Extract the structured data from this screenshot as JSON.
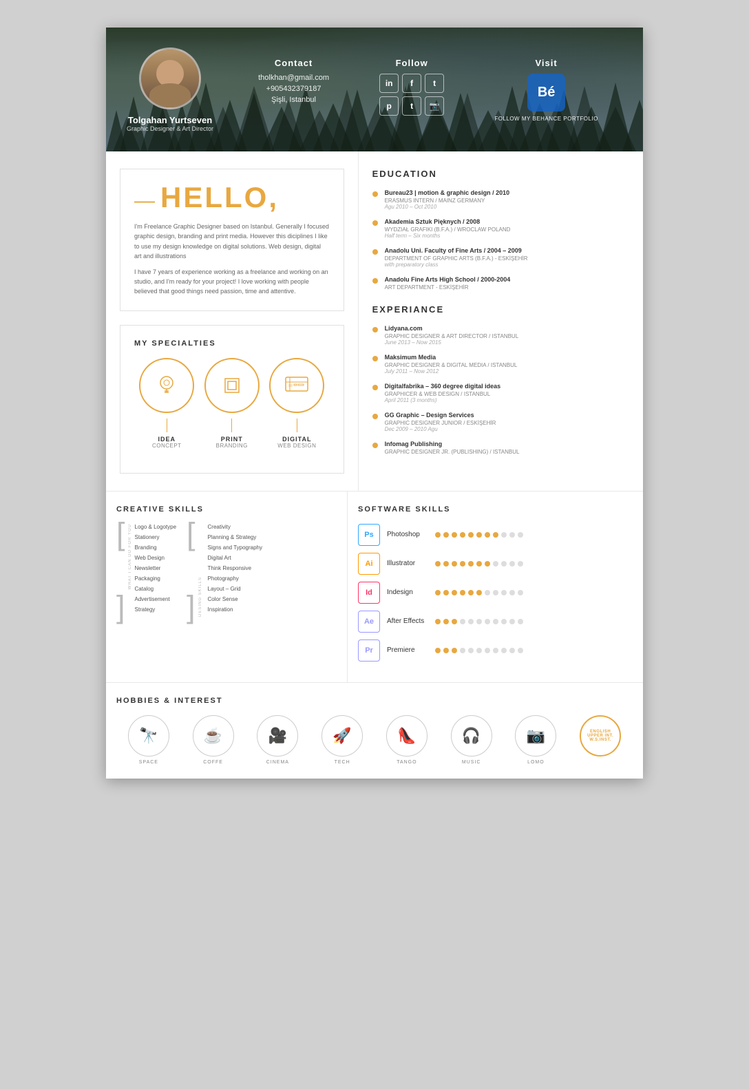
{
  "header": {
    "name": "Tolgahan Yurtseven",
    "title": "Graphic Designer & Art Director",
    "contact_title": "Contact",
    "email": "tholkhan@gmail.com",
    "phone": "+905432379187",
    "location": "Şişli, Istanbul",
    "follow_title": "Follow",
    "visit_title": "Visit",
    "behance_label": "FOLLOW MY BEHANCE PORTFOLIO",
    "social_icons": [
      "in",
      "f",
      "t",
      "p",
      "t",
      "📷"
    ]
  },
  "hello": {
    "greeting": "HELLO,",
    "dash": "—",
    "para1": "I'm Freelance Graphic Designer based on Istanbul. Generally I focused graphic design, branding and print media. However this diciplines I like to use my design knowledge on digital solutions. Web design, digital art and illustrations",
    "para2": "I have 7 years of experience working as a freelance and working on an studio, and I'm ready for your project! I love working with people believed that good things need passion, time and attentive."
  },
  "specialties": {
    "title": "MY SPECIALTIES",
    "items": [
      {
        "label": "IDEA",
        "sublabel": "CONCEPT",
        "icon": "💡"
      },
      {
        "label": "PRINT",
        "sublabel": "BRANDING",
        "icon": "🖨"
      },
      {
        "label": "DIGITAL",
        "sublabel": "WEB DESIGN",
        "icon": "🖥"
      }
    ]
  },
  "education": {
    "title": "EDUCATION",
    "items": [
      {
        "name": "Bureau23 | motion & graphic design / 2010",
        "sub": "ERASMUS INTERN / MAINZ GERMANY",
        "date": "Agu 2010 – Oct 2010"
      },
      {
        "name": "Akademia Sztuk Pięknych / 2008",
        "sub": "WYDZIAŁ GRAFIKI (B.F.A.) / WROCLAW POLAND",
        "date": "Half term – Six months"
      },
      {
        "name": "Anadolu Uni. Faculty of Fine Arts / 2004 – 2009",
        "sub": "DEPARTMENT OF GRAPHIC ARTS (B.F.A.) - ESKİŞEHİR",
        "date": "with preparatory class"
      },
      {
        "name": "Anadolu Fine Arts High School / 2000-2004",
        "sub": "ART DEPARTMENT - ESKİŞEHİR",
        "date": ""
      }
    ]
  },
  "experience": {
    "title": "EXPERIANCE",
    "items": [
      {
        "name": "Lidyana.com",
        "sub": "GRAPHIC DESIGNER & ART DIRECTOR / ISTANBUL",
        "date": "June 2013 – Now 2015"
      },
      {
        "name": "Maksimum Media",
        "sub": "GRAPHIC DESIGNER & DIGITAL MEDIA / ISTANBUL",
        "date": "July 2011 – Now 2012"
      },
      {
        "name": "Digitalfabrika – 360 degree digital ideas",
        "sub": "GRAPHICER & WEB DESIGN / ISTANBUL",
        "date": "April 2011 (3 months)"
      },
      {
        "name": "GG Graphic – Design Services",
        "sub": "GRAPHIC DESIGNER JUNIOR / ESKİŞEHİR",
        "date": "Dec 2009 – 2010 Agu"
      },
      {
        "name": "Infomag Publishing",
        "sub": "GRAPHIC DESIGNER JR. (PUBLISHING) / ISTANBUL",
        "date": ""
      }
    ]
  },
  "creative_skills": {
    "title": "CREATIVE SKILLS",
    "col1_label": "WHAT I CAN DO FOR YOU",
    "col1": [
      "Logo & Logotype",
      "Stationery",
      "Branding",
      "Web Design",
      "Newsletter",
      "Packaging",
      "Catalog",
      "Advertisement",
      "Strategy"
    ],
    "col2_label": "DESING SKILLS",
    "col2": [
      "Creativity",
      "Planning & Strategy",
      "Signs and Typography",
      "Digital Art",
      "Think Responsive",
      "Photography",
      "Layout – Grid",
      "Color Sense",
      "Inspiration"
    ]
  },
  "software_skills": {
    "title": "SOFTWARE SKILLS",
    "items": [
      {
        "badge": "Ps",
        "name": "Photoshop",
        "filled": 8,
        "total": 11
      },
      {
        "badge": "Ai",
        "name": "Illustrator",
        "filled": 7,
        "total": 11
      },
      {
        "badge": "Id",
        "name": "Indesign",
        "filled": 6,
        "total": 11
      },
      {
        "badge": "Ae",
        "name": "After Effects",
        "filled": 3,
        "total": 11
      },
      {
        "badge": "Pr",
        "name": "Premiere",
        "filled": 3,
        "total": 11
      }
    ]
  },
  "hobbies": {
    "title": "HOBBIES & INTEREST",
    "items": [
      {
        "label": "SPACE",
        "icon": "🔭"
      },
      {
        "label": "COFFE",
        "icon": "☕"
      },
      {
        "label": "CINEMA",
        "icon": "🎥"
      },
      {
        "label": "TECH",
        "icon": "🚀"
      },
      {
        "label": "TANGO",
        "icon": "👠"
      },
      {
        "label": "MUSIC",
        "icon": "🎧"
      },
      {
        "label": "LOMO",
        "icon": "📷"
      }
    ],
    "english": {
      "line1": "ENGLISH",
      "line2": "UPPER INT.",
      "line3": "W.S.INST."
    }
  }
}
